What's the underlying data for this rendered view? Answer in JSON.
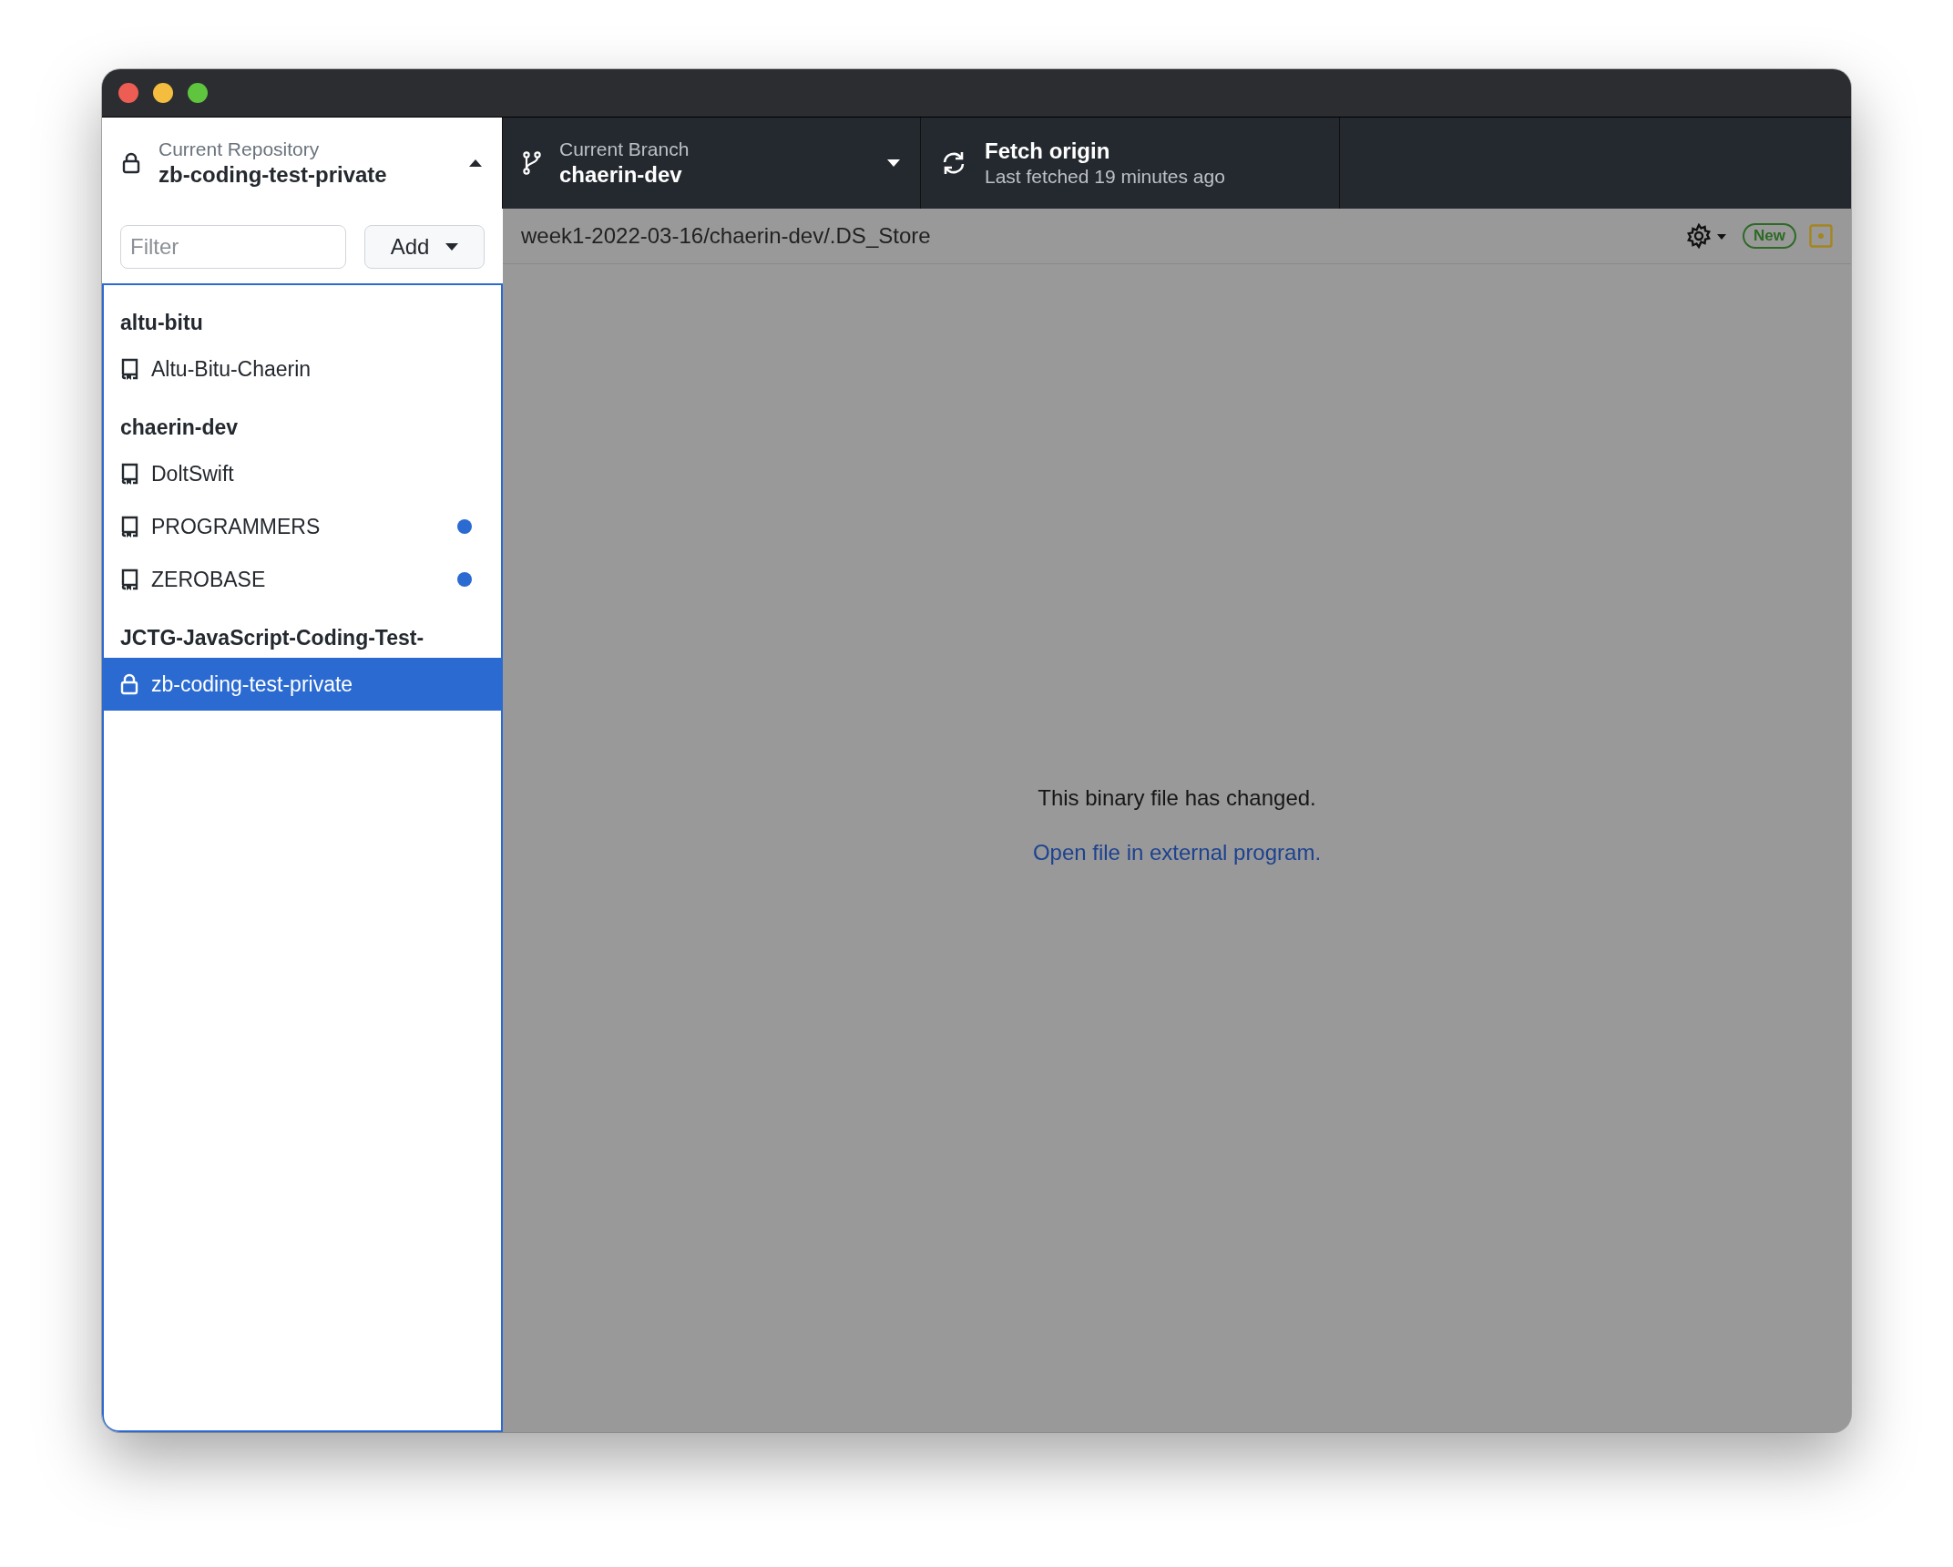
{
  "toolbar": {
    "repository": {
      "label": "Current Repository",
      "value": "zb-coding-test-private",
      "expanded": true
    },
    "branch": {
      "label": "Current Branch",
      "value": "chaerin-dev"
    },
    "fetch": {
      "label": "Fetch origin",
      "detail": "Last fetched 19 minutes ago"
    }
  },
  "sidebar": {
    "filter": {
      "placeholder": "Filter"
    },
    "add_button": "Add",
    "groups": [
      {
        "name": "altu-bitu",
        "items": [
          {
            "name": "Altu-Bitu-Chaerin",
            "kind": "public",
            "selected": false,
            "has_changes": false
          }
        ]
      },
      {
        "name": "chaerin-dev",
        "items": [
          {
            "name": "DoltSwift",
            "kind": "public",
            "selected": false,
            "has_changes": false
          },
          {
            "name": "PROGRAMMERS",
            "kind": "public",
            "selected": false,
            "has_changes": true
          },
          {
            "name": "ZEROBASE",
            "kind": "public",
            "selected": false,
            "has_changes": true
          }
        ]
      },
      {
        "name": "JCTG-JavaScript-Coding-Test-",
        "items": [
          {
            "name": "zb-coding-test-private",
            "kind": "private",
            "selected": true,
            "has_changes": false
          }
        ]
      }
    ]
  },
  "diff": {
    "file_path": "week1-2022-03-16/chaerin-dev/.DS_Store",
    "status_badge": "New",
    "message": "This binary file has changed.",
    "link": "Open file in external program."
  }
}
